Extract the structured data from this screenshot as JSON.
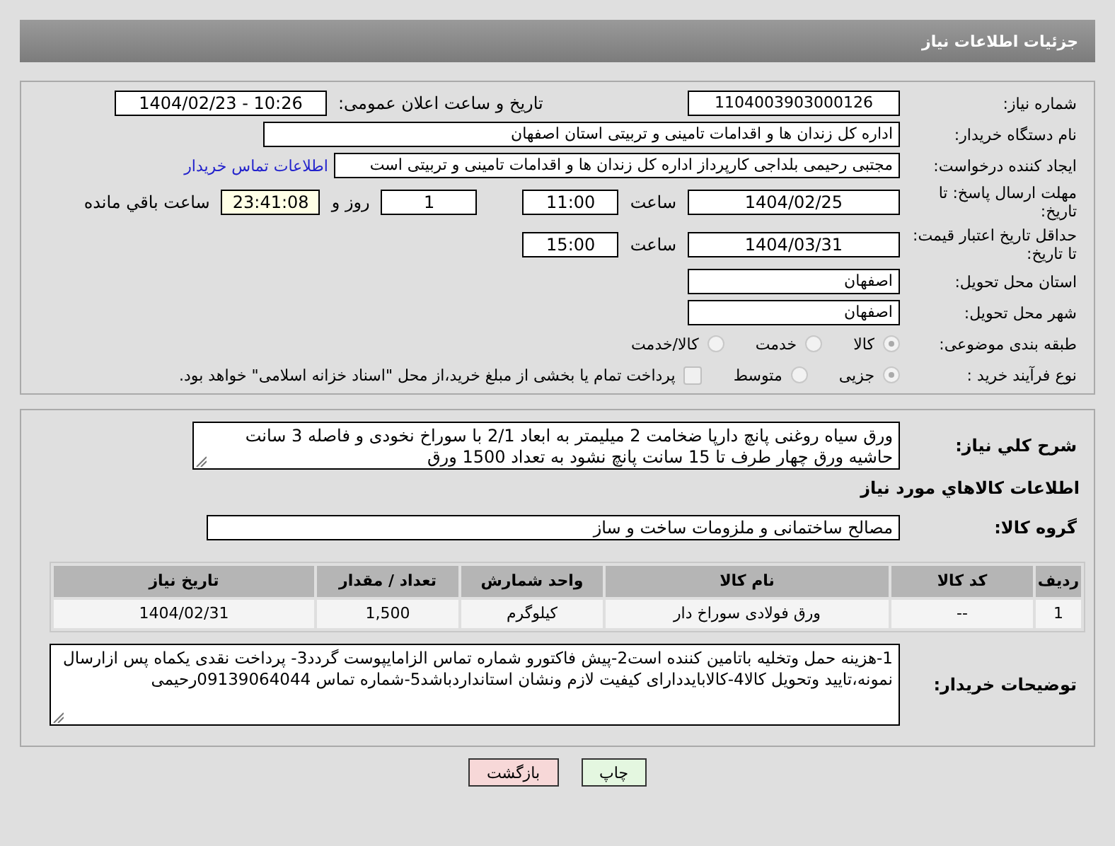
{
  "header": {
    "title": "جزئیات اطلاعات نیاز"
  },
  "need_number": {
    "label": "شماره نیاز:",
    "value": "1104003903000126"
  },
  "announce": {
    "label": "تاریخ و ساعت اعلان عمومی:",
    "value": "1404/02/23 - 10:26"
  },
  "buyer_org": {
    "label": "نام دستگاه خریدار:",
    "value": "اداره کل زندان ها و اقدامات تامینی و تربیتی استان اصفهان"
  },
  "creator": {
    "label": "ایجاد کننده درخواست:",
    "value": "مجتبی رحیمی بلداجی کارپرداز اداره کل زندان ها و اقدامات تامینی و تربیتی است",
    "link": "اطلاعات تماس خریدار"
  },
  "deadline": {
    "label": "مهلت ارسال پاسخ: تا تاریخ:",
    "date": "1404/02/25",
    "time_label": "ساعت",
    "time": "11:00",
    "days": "1",
    "days_label": "روز و",
    "remaining": "23:41:08",
    "remaining_label": "ساعت باقي مانده"
  },
  "validity": {
    "label": "حداقل تاریخ اعتبار قیمت: تا تاریخ:",
    "date": "1404/03/31",
    "time_label": "ساعت",
    "time": "15:00"
  },
  "province": {
    "label": "استان محل تحویل:",
    "value": "اصفهان"
  },
  "city": {
    "label": "شهر محل تحویل:",
    "value": "اصفهان"
  },
  "category": {
    "label": "طبقه بندی موضوعی:",
    "options": [
      {
        "label": "کالا",
        "selected": true
      },
      {
        "label": "خدمت",
        "selected": false
      },
      {
        "label": "کالا/خدمت",
        "selected": false
      }
    ]
  },
  "process": {
    "label": "نوع فرآیند خرید :",
    "options": [
      {
        "label": "جزیی",
        "selected": true
      },
      {
        "label": "متوسط",
        "selected": false
      }
    ],
    "payment": {
      "checked": false,
      "label": "پرداخت تمام یا بخشی از مبلغ خرید،از محل \"اسناد خزانه اسلامی\" خواهد بود."
    }
  },
  "description": {
    "label": "شرح کلي نياز:",
    "value": "ورق سیاه روغنی پانچ دارپا ضخامت 2 میلیمتر به ابعاد 2/1 با سوراخ نخودی و فاصله 3 سانت حاشیه ورق چهار طرف تا 15 سانت پانچ نشود به تعداد 1500 ورق"
  },
  "goods_heading": "اطلاعات کالاهاي مورد نياز",
  "goods_group": {
    "label": "گروه کالا:",
    "value": "مصالح ساختمانی و ملزومات ساخت و ساز"
  },
  "table": {
    "columns": [
      "ردیف",
      "کد کالا",
      "نام کالا",
      "واحد شمارش",
      "تعداد / مقدار",
      "تاریخ نیاز"
    ],
    "rows": [
      [
        "1",
        "--",
        "ورق فولادی سوراخ دار",
        "کیلوگرم",
        "1,500",
        "1404/02/31"
      ]
    ]
  },
  "buyer_notes": {
    "label": "توضیحات خریدار:",
    "value": "1-هزینه حمل وتخلیه باتامین کننده است2-پیش فاکتورو شماره تماس الزامایپوست گردد3- پرداخت نقدی یکماه  پس ازارسال نمونه،تایید وتحویل کالا4-کالابایددارای کیفیت لازم ونشان استانداردباشد5-شماره تماس 09139064044رحیمی"
  },
  "buttons": [
    {
      "label": "چاپ",
      "kind": "print"
    },
    {
      "label": "بازگشت",
      "kind": "back"
    }
  ]
}
